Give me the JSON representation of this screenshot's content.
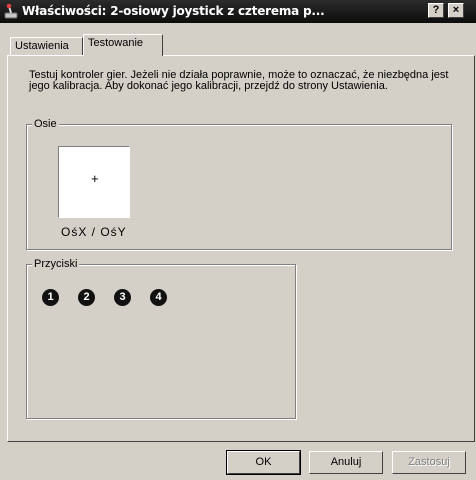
{
  "window": {
    "title": "Właściwości: 2-osiowy joystick z czterema p...",
    "help_btn": "?",
    "close_btn": "×"
  },
  "tabs": [
    {
      "label": "Ustawienia",
      "active": false
    },
    {
      "label": "Testowanie",
      "active": true
    }
  ],
  "description": "Testuj kontroler gier. Jeżeli nie działa poprawnie, może to oznaczać, że niezbędna jest jego kalibracja. Aby dokonać jego kalibracji, przejdź do strony Ustawienia.",
  "axes": {
    "group_label": "Osie",
    "crosshair": "+",
    "axis_label": "OśX / OśY"
  },
  "buttons_group": {
    "label": "Przyciski",
    "buttons": [
      "1",
      "2",
      "3",
      "4"
    ]
  },
  "dialog_buttons": {
    "ok": "OK",
    "cancel": "Anuluj",
    "apply": "Zastosuj"
  }
}
